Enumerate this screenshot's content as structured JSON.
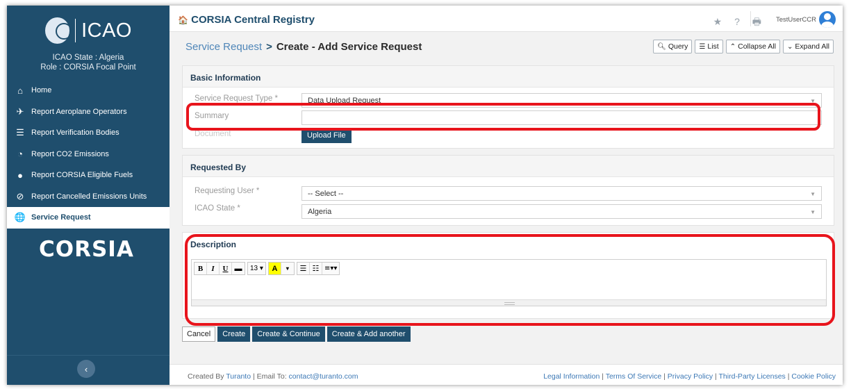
{
  "brand": {
    "logo_text": "ICAO",
    "state_line": "ICAO State : Algeria",
    "role_line": "Role : CORSIA Focal Point",
    "corsia_logo": "CORSIA"
  },
  "sidebar": {
    "items": [
      {
        "label": "Home",
        "icon": "home-icon"
      },
      {
        "label": "Report Aeroplane Operators",
        "icon": "airplane-icon"
      },
      {
        "label": "Report Verification Bodies",
        "icon": "report-icon"
      },
      {
        "label": "Report CO2 Emissions",
        "icon": "co2-icon"
      },
      {
        "label": "Report CORSIA Eligible Fuels",
        "icon": "fuel-drop-icon"
      },
      {
        "label": "Report Cancelled Emissions Units",
        "icon": "cancelled-icon"
      },
      {
        "label": "Service Request",
        "icon": "globe-icon",
        "active": true
      }
    ],
    "collapse_glyph": "‹"
  },
  "header": {
    "title": "CORSIA Central Registry",
    "home_glyph": "🏠",
    "icons_text": "★ ? 🖶",
    "username": "TestUserCCR"
  },
  "breadcrumb": {
    "parent": "Service Request",
    "separator": ">",
    "current": "Create - Add Service Request"
  },
  "toolbar": {
    "query": "Query",
    "list": "List",
    "collapse_all": "Collapse All",
    "expand_all": "Expand All"
  },
  "basic_info": {
    "title": "Basic Information",
    "type_label": "Service Request Type *",
    "type_value": "Data Upload Request",
    "summary_label": "Summary",
    "summary_value": "",
    "document_label": "Document",
    "upload_label": "Upload File"
  },
  "requested_by": {
    "title": "Requested By",
    "user_label": "Requesting User *",
    "user_value": "-- Select --",
    "state_label": "ICAO State *",
    "state_value": "Algeria"
  },
  "description": {
    "title": "Description",
    "font_size": "13"
  },
  "actions": {
    "cancel": "Cancel",
    "create": "Create",
    "create_continue": "Create & Continue",
    "create_add_another": "Create & Add another"
  },
  "footer": {
    "created_by_prefix": "Created By ",
    "company": "Turanto",
    "email_prefix": " | Email To: ",
    "email": "contact@turanto.com",
    "links": [
      "Legal Information",
      "Terms Of Service",
      "Privacy Policy",
      "Third-Party Licenses",
      "Cookie Policy"
    ]
  },
  "colors": {
    "sidebar_bg": "#1f4e6d",
    "highlight": "#e8141c",
    "link": "#3c78b5"
  }
}
